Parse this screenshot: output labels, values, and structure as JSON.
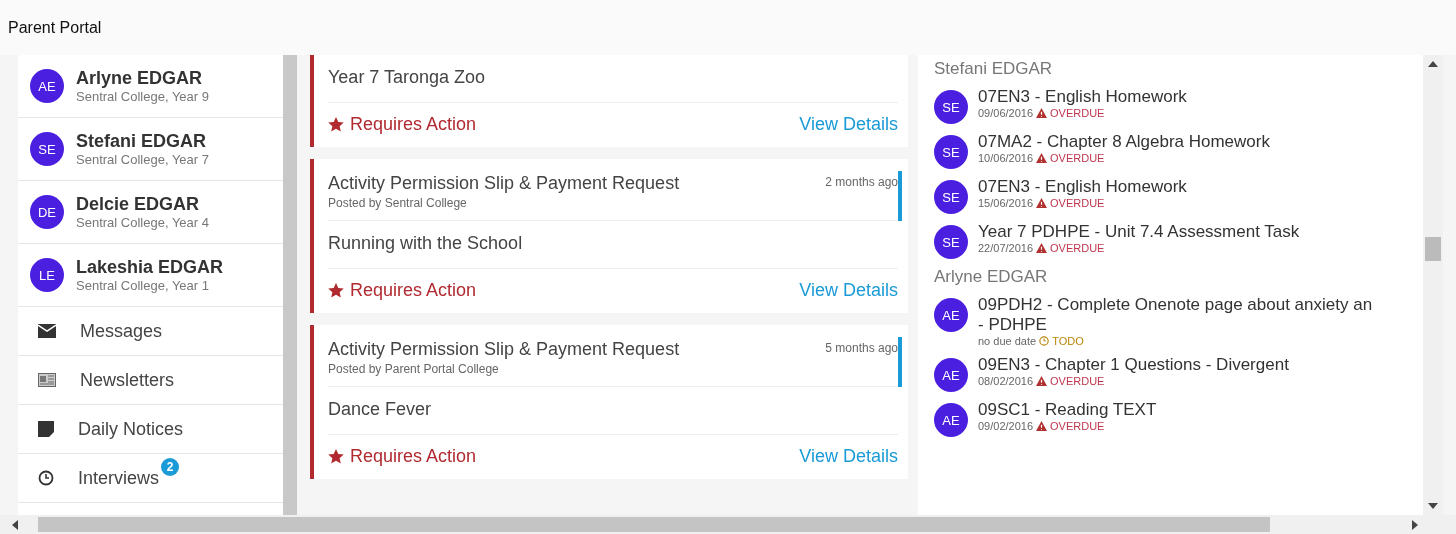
{
  "window": {
    "title": "Parent Portal"
  },
  "sidebar": {
    "students": [
      {
        "initials": "AE",
        "name": "Arlyne EDGAR",
        "school": "Sentral College, Year 9"
      },
      {
        "initials": "SE",
        "name": "Stefani EDGAR",
        "school": "Sentral College, Year 7"
      },
      {
        "initials": "DE",
        "name": "Delcie EDGAR",
        "school": "Sentral College, Year 4"
      },
      {
        "initials": "LE",
        "name": "Lakeshia EDGAR",
        "school": "Sentral College, Year 1"
      }
    ],
    "items": [
      {
        "kind": "messages",
        "label": "Messages"
      },
      {
        "kind": "newsletters",
        "label": "Newsletters"
      },
      {
        "kind": "notices",
        "label": "Daily Notices"
      },
      {
        "kind": "interviews",
        "label": "Interviews",
        "badge": "2"
      }
    ]
  },
  "notices": [
    {
      "unread": false,
      "body": "Year 7 Taronga Zoo",
      "status": "Requires Action",
      "link": "View Details"
    },
    {
      "unread": true,
      "title": "Activity Permission Slip & Payment Request",
      "time": "2 months ago",
      "posted_by": "Posted by Sentral College",
      "body": "Running with the School",
      "status": "Requires Action",
      "link": "View Details"
    },
    {
      "unread": true,
      "title": "Activity Permission Slip & Payment Request",
      "time": "5 months ago",
      "posted_by": "Posted by Parent Portal College",
      "body": "Dance Fever",
      "status": "Requires Action",
      "link": "View Details"
    }
  ],
  "tasks": [
    {
      "student": "Stefani EDGAR",
      "items": [
        {
          "initials": "SE",
          "title": "07EN3 - English Homework",
          "due": "09/06/2016",
          "kind": "overdue",
          "status": "OVERDUE"
        },
        {
          "initials": "SE",
          "title": "07MA2 - Chapter 8 Algebra Homework",
          "due": "10/06/2016",
          "kind": "overdue",
          "status": "OVERDUE"
        },
        {
          "initials": "SE",
          "title": "07EN3 - English Homework",
          "due": "15/06/2016",
          "kind": "overdue",
          "status": "OVERDUE"
        },
        {
          "initials": "SE",
          "title": "Year 7 PDHPE - Unit 7.4 Assessment Task",
          "due": "22/07/2016",
          "kind": "overdue",
          "status": "OVERDUE"
        }
      ]
    },
    {
      "student": "Arlyne EDGAR",
      "items": [
        {
          "initials": "AE",
          "title": "09PDH2 - Complete Onenote page about anxiety an",
          "title_continued": "- PDHPE",
          "due": "no due date",
          "kind": "todo",
          "status": "TODO"
        },
        {
          "initials": "AE",
          "title": "09EN3 - Chapter 1 Questions - Divergent",
          "due": "08/02/2016",
          "kind": "overdue",
          "status": "OVERDUE"
        },
        {
          "initials": "AE",
          "title": "09SC1 - Reading TEXT",
          "due": "09/02/2016",
          "kind": "overdue",
          "status": "OVERDUE"
        }
      ]
    }
  ]
}
